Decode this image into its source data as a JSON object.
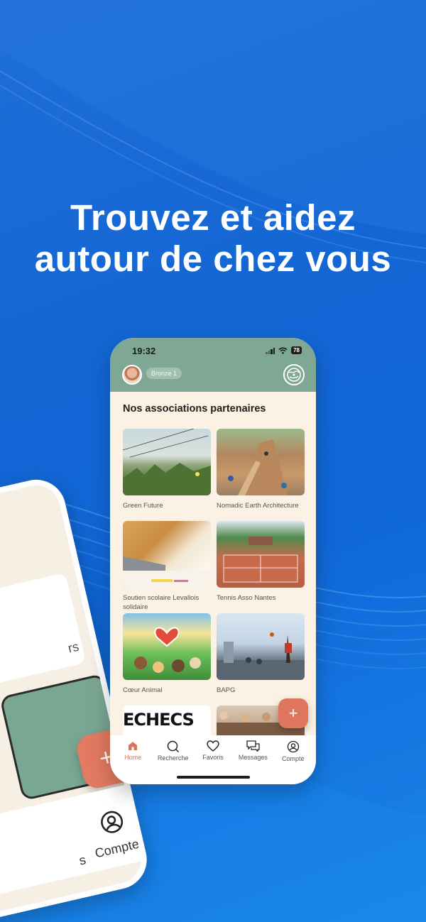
{
  "headline": {
    "line1": "Trouvez et aidez",
    "line2": "autour de chez vous"
  },
  "colors": {
    "background": "#1466d4",
    "header_green": "#7fa894",
    "accent": "#e0755e",
    "page_bg": "#fbf1e4"
  },
  "status_bar": {
    "time": "19:32",
    "battery": "78"
  },
  "header": {
    "rank_badge": "Bronze 1",
    "logo_icon": "globe-hands-icon"
  },
  "main": {
    "section_title": "Nos associations partenaires",
    "associations": [
      {
        "name": "Green Future",
        "image": "dune-grass-photo"
      },
      {
        "name": "Nomadic Earth Architecture",
        "image": "earth-building-photo"
      },
      {
        "name": "Soutien scolaire Levallois solidaire",
        "image": "student-writing-photo"
      },
      {
        "name": "Tennis Asso Nantes",
        "image": "tennis-courts-photo"
      },
      {
        "name": "Cœur Animal",
        "image": "animals-illustration"
      },
      {
        "name": "BAPG",
        "image": "basketball-photo"
      },
      {
        "name": "",
        "image": "chess-logo-image",
        "image_text": "ECHECS"
      },
      {
        "name": "",
        "image": "group-people-photo"
      }
    ],
    "fab_label": "+"
  },
  "tabbar": {
    "items": [
      {
        "label": "Home",
        "icon": "home-icon",
        "active": true
      },
      {
        "label": "Recherche",
        "icon": "search-icon",
        "active": false
      },
      {
        "label": "Favoris",
        "icon": "heart-icon",
        "active": false
      },
      {
        "label": "Messages",
        "icon": "messages-icon",
        "active": false
      },
      {
        "label": "Compte",
        "icon": "account-icon",
        "active": false
      }
    ]
  },
  "back_phone": {
    "fab_label": "+",
    "tab_label": "Compte",
    "partial_text_1": "rs",
    "partial_text_2": "s"
  }
}
